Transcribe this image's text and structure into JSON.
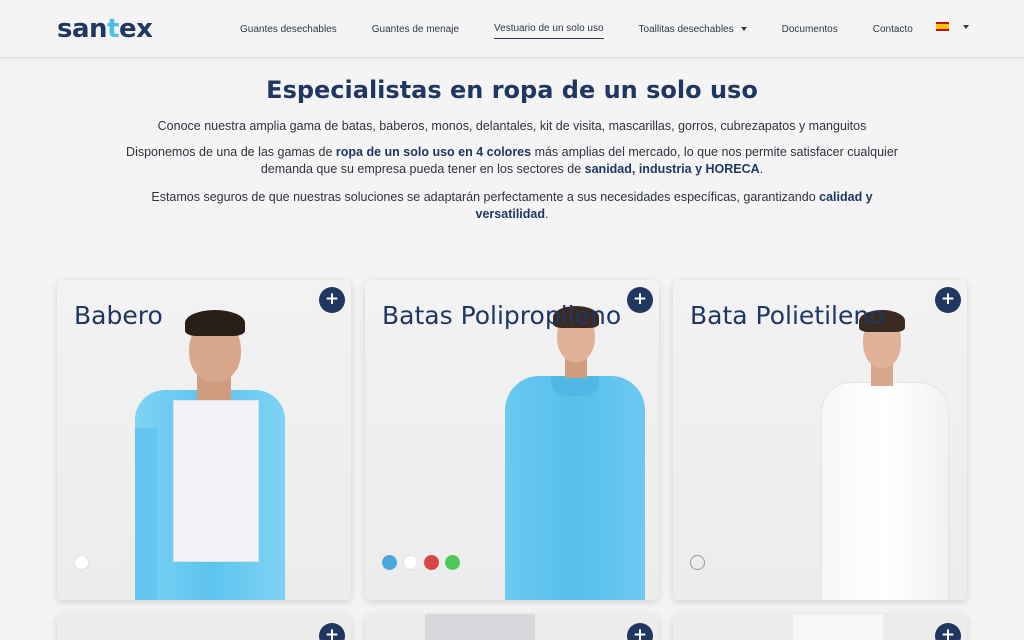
{
  "brand": {
    "logo_text_a": "san",
    "logo_text_dot": "t",
    "logo_text_b": "ex"
  },
  "nav": {
    "items": [
      {
        "label": "Guantes desechables"
      },
      {
        "label": "Guantes de menaje"
      },
      {
        "label": "Vestuario de un solo uso"
      },
      {
        "label": "Toallitas desechables"
      },
      {
        "label": "Documentos"
      },
      {
        "label": "Contacto"
      }
    ],
    "language_icon": "spain-flag-icon"
  },
  "hero": {
    "title": "Especialistas en ropa de un solo uso",
    "p1": "Conoce nuestra amplia gama de batas, baberos, monos, delantales, kit de visita, mascarillas, gorros, cubrezapatos y manguitos",
    "p2_a": "Disponemos de una de las gamas de ",
    "p2_b": "ropa de un solo uso en 4 colores",
    "p2_c": " más amplias del mercado, lo que nos permite satisfacer cualquier demanda que su empresa pueda tener en los sectores de ",
    "p2_d": "sanidad, industria y HORECA",
    "p2_e": ".",
    "p3_a": "Estamos seguros de que nuestras soluciones se adaptarán perfectamente a sus necesidades específicas, garantizando ",
    "p3_b": "calidad y versatilidad",
    "p3_c": "."
  },
  "cards": [
    {
      "title": "Babero",
      "plus": "+",
      "colors": [
        "#ffffff"
      ]
    },
    {
      "title": "Batas Polipropileno",
      "plus": "+",
      "colors": [
        "#4aa8dc",
        "#ffffff",
        "#d94444",
        "#4cc95a"
      ]
    },
    {
      "title": "Bata Polietileno",
      "plus": "+",
      "colors": [
        "outline"
      ]
    }
  ],
  "partial_cards": [
    {
      "plus": "+"
    },
    {
      "plus": "+"
    },
    {
      "plus": "+"
    }
  ],
  "colors": {
    "brand_navy": "#1f3761",
    "accent_cyan": "#4fc1e0",
    "gown_blue": "#5cc4ef"
  }
}
